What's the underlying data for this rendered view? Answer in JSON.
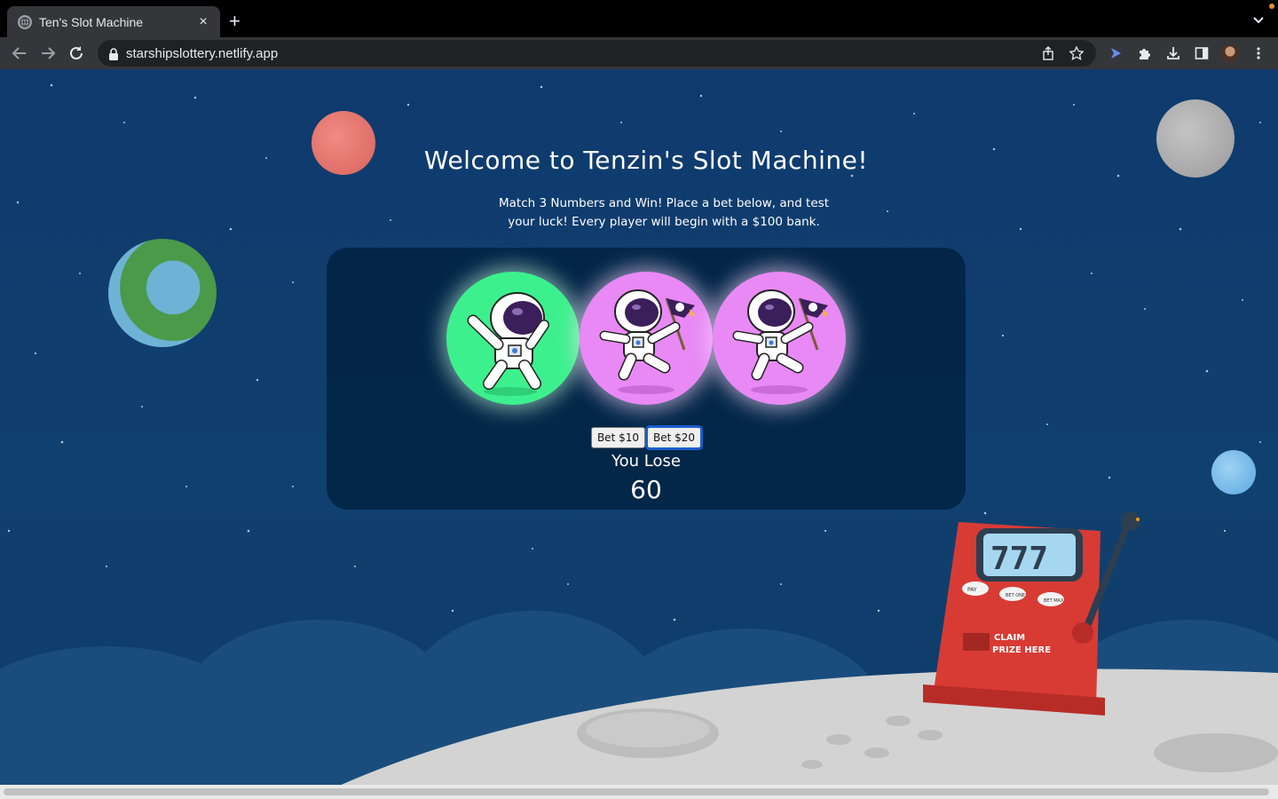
{
  "browser": {
    "tab_title": "Ten's Slot Machine",
    "tab_close": "×",
    "new_tab": "+",
    "url": "starshipslottery.netlify.app"
  },
  "page": {
    "title": "Welcome to Tenzin's Slot Machine!",
    "subtitle": "Match 3 Numbers and Win! Place a bet below, and test your luck! Every player will begin with a $100 bank.",
    "reels": [
      {
        "name": "dabbing-astronaut",
        "color": "#3cf18d"
      },
      {
        "name": "flag-astronaut",
        "color": "#e889f5"
      },
      {
        "name": "flag-astronaut",
        "color": "#e889f5"
      }
    ],
    "bet_buttons": [
      "Bet $10",
      "Bet $20"
    ],
    "result_text": "You Lose",
    "bank": "60",
    "decor": {
      "machine_reels": "777",
      "machine_buttons": [
        "PAY",
        "BET ONE",
        "BET MAX"
      ],
      "claim_label": "CLAIM PRIZE HERE"
    }
  }
}
